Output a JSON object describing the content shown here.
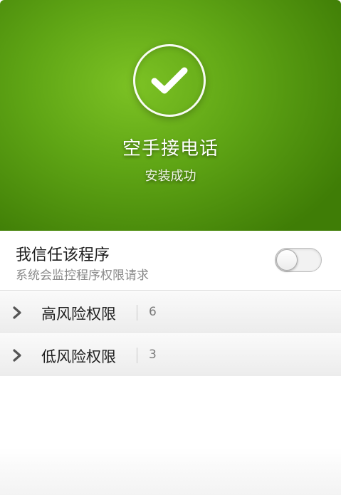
{
  "header": {
    "icon": "checkmark-circle-icon",
    "app_name": "空手接电话",
    "status": "安装成功",
    "bg_color": "#5fa515"
  },
  "trust": {
    "title": "我信任该程序",
    "subtitle": "系统会监控程序权限请求",
    "toggle_on": false
  },
  "permissions": [
    {
      "label": "高风险权限",
      "count": "6",
      "icon": "chevron-right-icon"
    },
    {
      "label": "低风险权限",
      "count": "3",
      "icon": "chevron-right-icon"
    }
  ]
}
